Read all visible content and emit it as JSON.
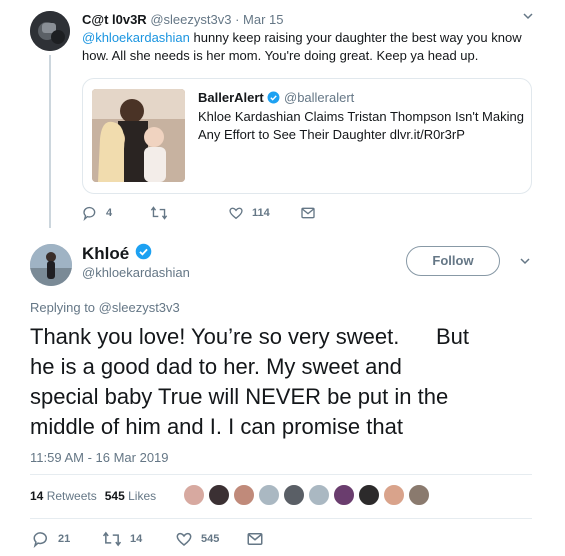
{
  "reply": {
    "name": "C@t l0v3R",
    "handle": "@sleezyst3v3",
    "separator": "·",
    "date": "Mar 15",
    "mention": "@khloekardashian",
    "text": " hunny keep raising your daughter the best way you know how. All she needs is her mom. You're doing great. Keep ya head up.",
    "card": {
      "source_name": "BallerAlert",
      "source_handle": "@balleralert",
      "text": "Khloe Kardashian Claims Tristan Thompson Isn't Making Any Effort to See Their Daughter dlvr.it/R0r3rP"
    },
    "actions": {
      "replies": "4",
      "retweets": "",
      "likes": "114"
    }
  },
  "main": {
    "name": "Khloé",
    "handle": "@khloekardashian",
    "follow_label": "Follow",
    "replying_to": "Replying to @sleezyst3v3",
    "text": "Thank you love! You’re so very sweet.      But\nhe is a good dad to her. My sweet and\nspecial baby True will NEVER be put in the\nmiddle of him and I. I can promise that",
    "timestamp": "11:59 AM - 16 Mar 2019",
    "retweets_count": "14",
    "retweets_label": "Retweets",
    "likes_count": "545",
    "likes_label": "Likes",
    "likers": [
      "#d7a9a0",
      "#3b3033",
      "#c08a7a",
      "#aab8c2",
      "#5a5f66",
      "#aab8c2",
      "#6a3d6e",
      "#2c2a2b",
      "#d9a38b",
      "#8a7a6e"
    ],
    "actions": {
      "replies": "21",
      "retweets": "14",
      "likes": "545"
    }
  },
  "colors": {
    "accent": "#1da1f2",
    "link": "#1b95e0",
    "muted": "#657786"
  }
}
